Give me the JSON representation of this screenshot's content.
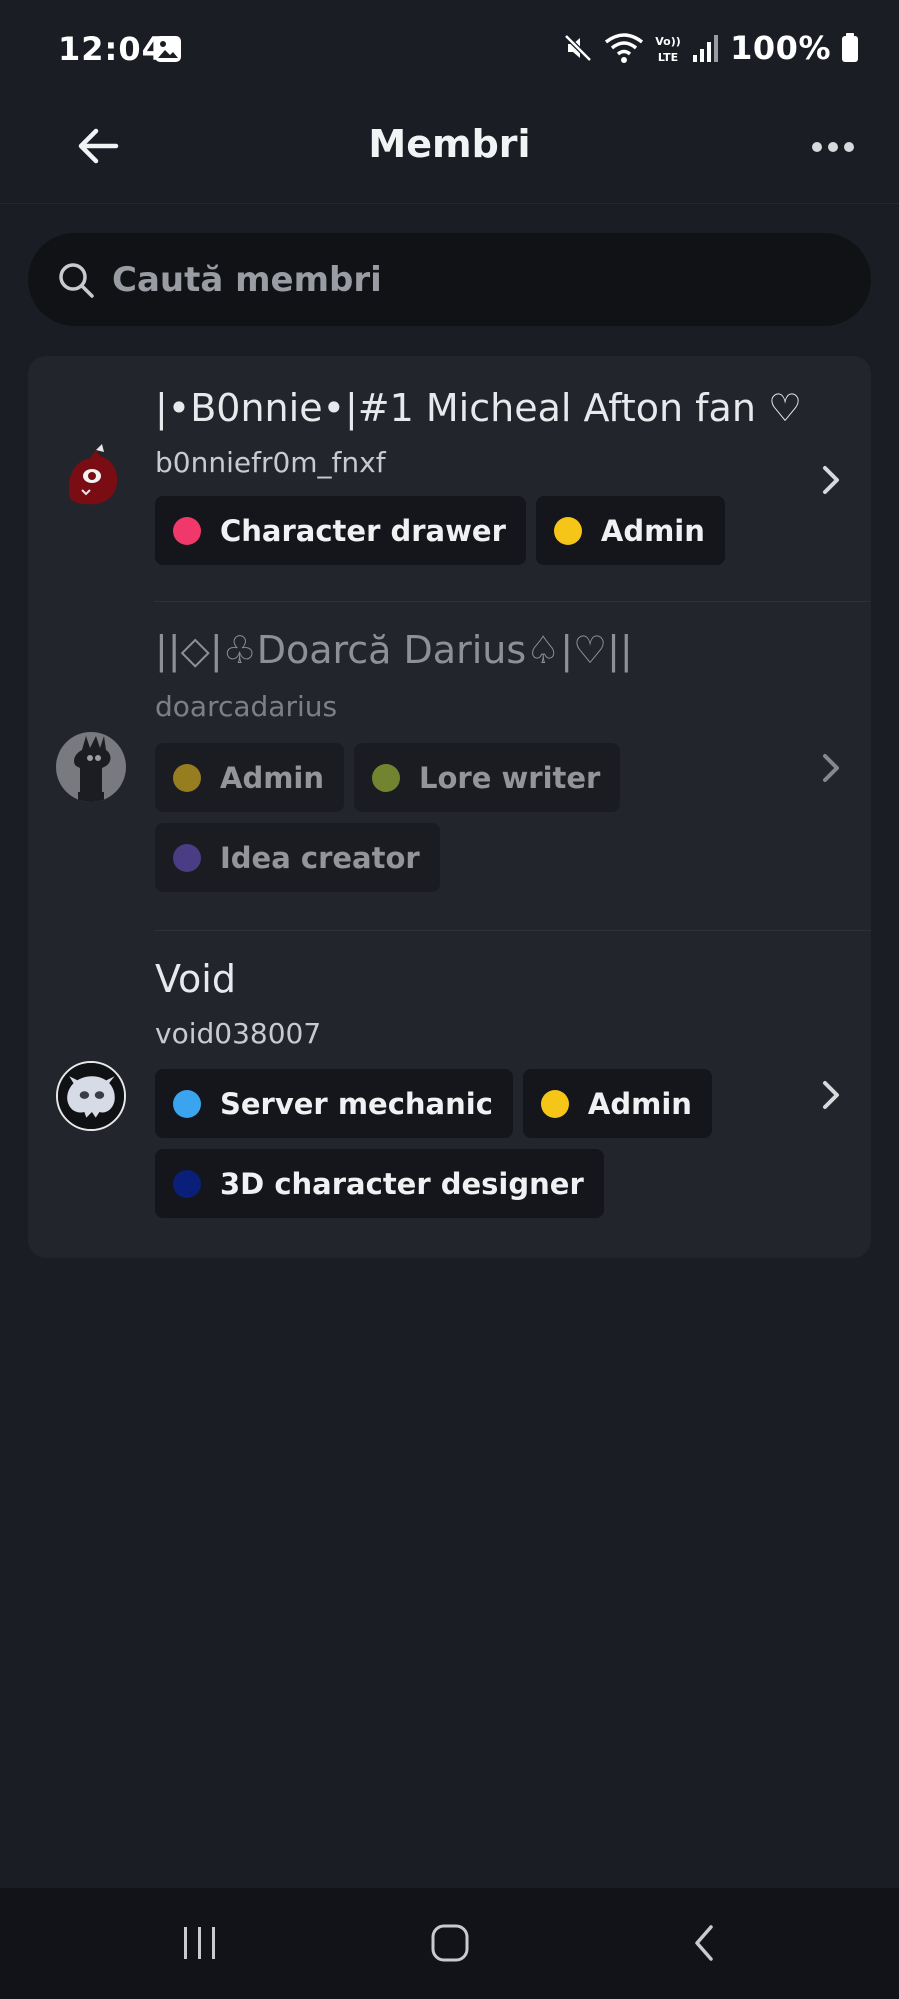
{
  "status_bar": {
    "time": "12:04",
    "battery": "100%",
    "network_label": "Vo)) LTE",
    "icons": [
      "gallery-icon",
      "mute-icon",
      "wifi-icon",
      "volte-icon",
      "signal-icon",
      "battery-icon"
    ]
  },
  "header": {
    "title": "Membri",
    "back_icon": "arrow-left-icon",
    "more_icon": "more-horizontal-icon"
  },
  "search": {
    "placeholder": "Caută membri",
    "value": ""
  },
  "members": [
    {
      "display_name": "|•B0nnie•|#1 Micheal Afton fan ♡",
      "username": "b0nniefr0m_fnxf",
      "dimmed": false,
      "avatar": "red-creature-avatar",
      "roles": [
        {
          "label": "Character drawer",
          "color": "#f0386b"
        },
        {
          "label": "Admin",
          "color": "#f5c518"
        }
      ]
    },
    {
      "display_name": "||◇|♧Doarcă Darius♤|♡||",
      "username": "doarcadarius",
      "dimmed": true,
      "avatar": "bunny-figure-avatar",
      "roles": [
        {
          "label": "Admin",
          "color": "#f5c518"
        },
        {
          "label": "Lore writer",
          "color": "#b5d334"
        },
        {
          "label": "Idea creator",
          "color": "#6a4fcf"
        }
      ]
    },
    {
      "display_name": "Void",
      "username": "void038007",
      "dimmed": false,
      "avatar": "white-creature-avatar",
      "roles": [
        {
          "label": "Server mechanic",
          "color": "#3ba4ee"
        },
        {
          "label": "Admin",
          "color": "#f5c518"
        },
        {
          "label": "3D character designer",
          "color": "#0a1f7a"
        }
      ]
    }
  ],
  "nav_bar": {
    "icons": [
      "recent-apps-icon",
      "home-icon",
      "back-icon"
    ]
  }
}
